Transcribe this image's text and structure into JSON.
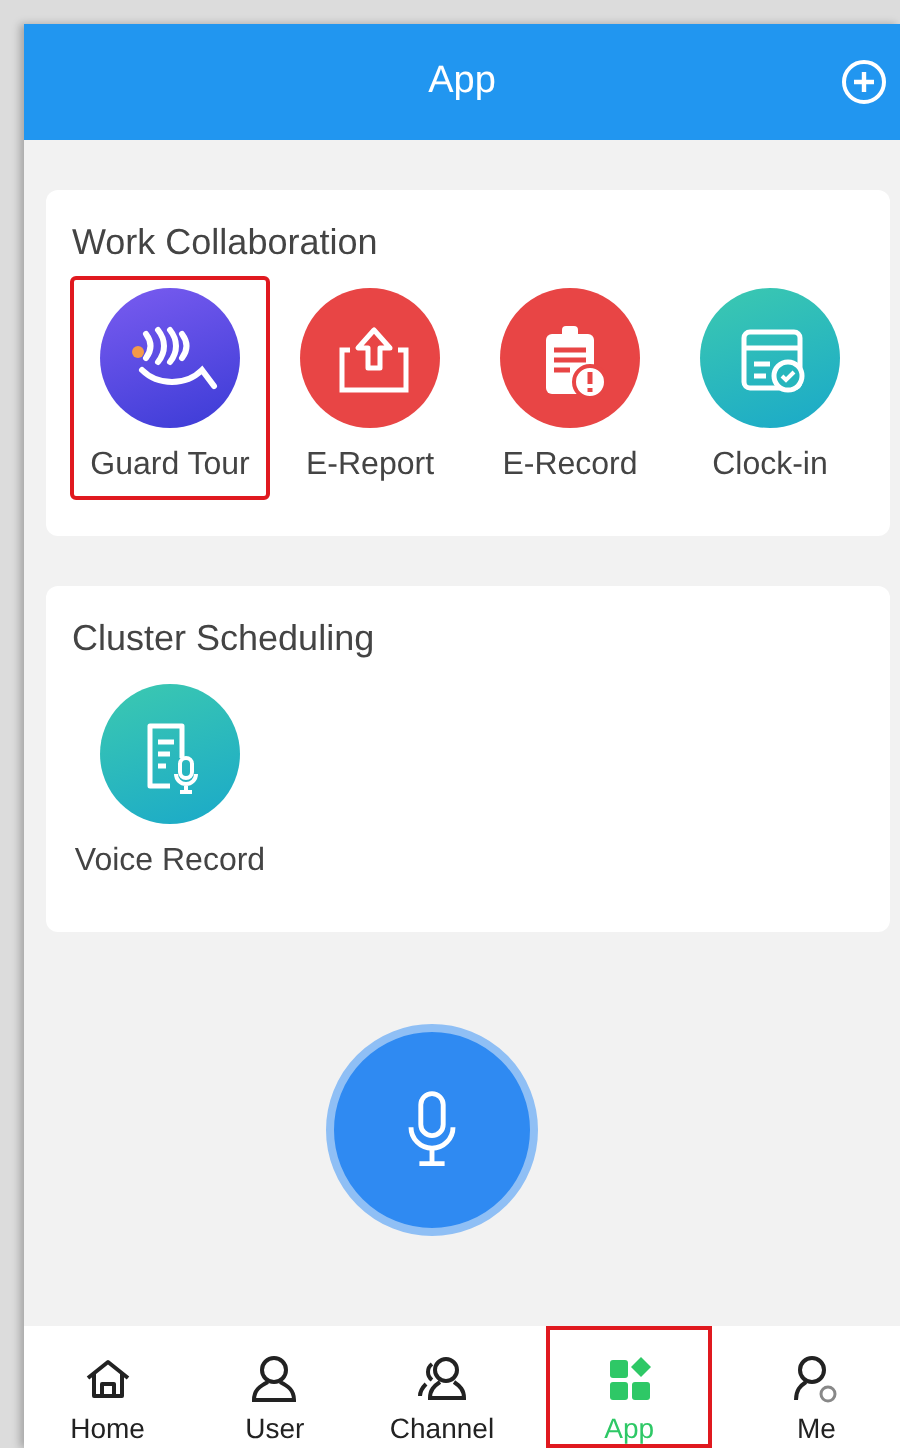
{
  "header": {
    "title": "App"
  },
  "sections": [
    {
      "title": "Work Collaboration",
      "apps": [
        {
          "label": "Guard Tour",
          "kind": "guard",
          "highlighted": true
        },
        {
          "label": "E-Report",
          "kind": "report",
          "highlighted": false
        },
        {
          "label": "E-Record",
          "kind": "record",
          "highlighted": false
        },
        {
          "label": "Clock-in",
          "kind": "clock",
          "highlighted": false
        }
      ]
    },
    {
      "title": "Cluster Scheduling",
      "apps": [
        {
          "label": "Voice Record",
          "kind": "voice",
          "highlighted": false
        }
      ]
    }
  ],
  "nav": [
    {
      "label": "Home",
      "kind": "home",
      "selected": false,
      "highlighted": false
    },
    {
      "label": "User",
      "kind": "user",
      "selected": false,
      "highlighted": false
    },
    {
      "label": "Channel",
      "kind": "channel",
      "selected": false,
      "highlighted": false
    },
    {
      "label": "App",
      "kind": "app",
      "selected": true,
      "highlighted": true
    },
    {
      "label": "Me",
      "kind": "me",
      "selected": false,
      "highlighted": false
    }
  ]
}
